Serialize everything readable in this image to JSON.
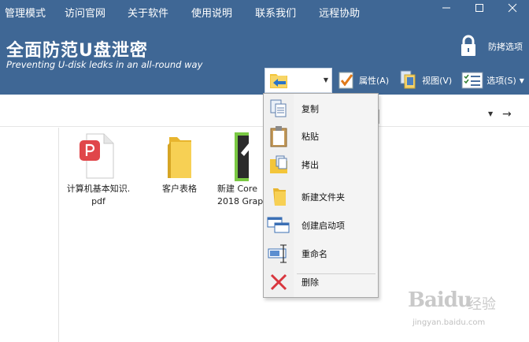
{
  "menubar": {
    "items": [
      "管理模式",
      "访问官网",
      "关于软件",
      "使用说明",
      "联系我们",
      "远程协助"
    ]
  },
  "header": {
    "title": "全面防范U盘泄密",
    "subtitle": "Preventing U-disk ledks in an all-round way",
    "lock_label": "防拷选项"
  },
  "toolbar": {
    "properties": "属性(A)",
    "view": "视图(V)",
    "options": "选项(S)"
  },
  "context_menu": {
    "items": [
      "复制",
      "粘贴",
      "拷出",
      "新建文件夹",
      "创建启动项",
      "重命名",
      "删除"
    ]
  },
  "files": [
    {
      "name_line1": "计算机基本知识.",
      "name_line2": "pdf"
    },
    {
      "name_line1": "客户表格",
      "name_line2": ""
    },
    {
      "name_line1": "新建 Core",
      "name_line2": "2018 Grap"
    }
  ],
  "watermark": {
    "logo": "Baidu",
    "cn": "经验",
    "url": "jingyan.baidu.com"
  },
  "colors": {
    "header_bg": "#3f6795",
    "accent_red": "#d9363e",
    "folder_yellow": "#f3c53a"
  }
}
